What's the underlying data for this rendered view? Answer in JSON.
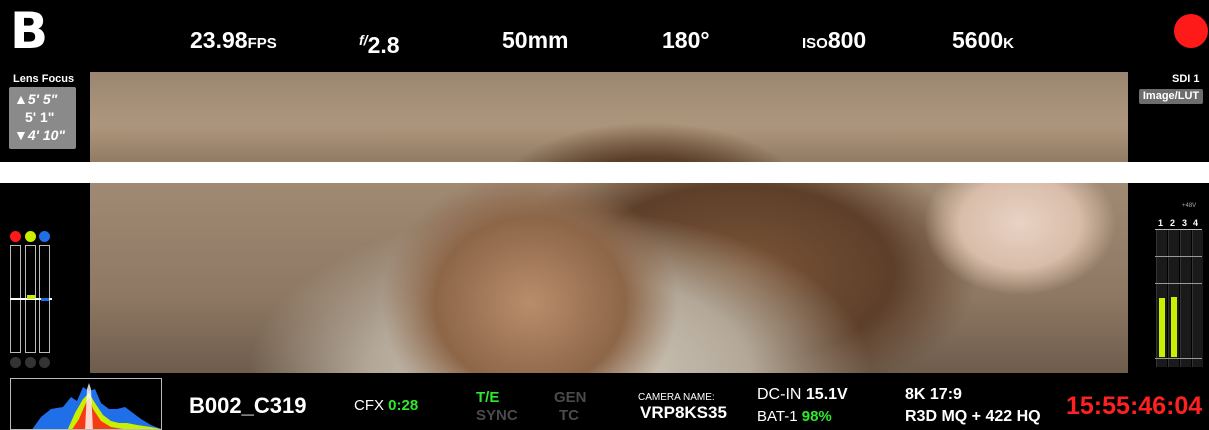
{
  "camera_id": "B",
  "top": {
    "fps_value": "23.98",
    "fps_unit": "FPS",
    "aperture_prefix": "f/",
    "aperture_value": "2.8",
    "focal_length": "50mm",
    "shutter_angle": "180°",
    "iso_prefix": "ISO",
    "iso_value": "800",
    "wb_value": "5600",
    "wb_unit": "K",
    "record_indicator_color": "#ff1a1a"
  },
  "lens_focus": {
    "title": "Lens Focus",
    "far": "▲5' 5\"",
    "current": "5' 1\"",
    "near": "▼4' 10\""
  },
  "sdi": {
    "label": "SDI 1",
    "mode": "Image/LUT"
  },
  "audio_meters": {
    "channels": [
      "1",
      "2",
      "3",
      "4"
    ],
    "phantom_label": "+48V",
    "levels": [
      0.43,
      0.44,
      0.0,
      0.0
    ]
  },
  "rgb_meters": {
    "channels": [
      "red",
      "green",
      "blue"
    ],
    "colors": [
      "#ff1a1a",
      "#c8f000",
      "#1f6fe8"
    ]
  },
  "bottom": {
    "clip_name": "B002_C319",
    "media_label": "CFX",
    "media_time": "0:28",
    "timecode_source": "T/E",
    "sync": "SYNC",
    "gen": "GEN",
    "tc": "TC",
    "camera_name_label": "CAMERA NAME:",
    "camera_name": "VRP8KS35",
    "dc_label": "DC-IN",
    "dc_value": "15.1V",
    "bat_label": "BAT-1",
    "bat_value": "98%",
    "resolution": "8K 17:9",
    "codec": "R3D MQ + 422 HQ",
    "timecode": "15:55:46:04"
  }
}
